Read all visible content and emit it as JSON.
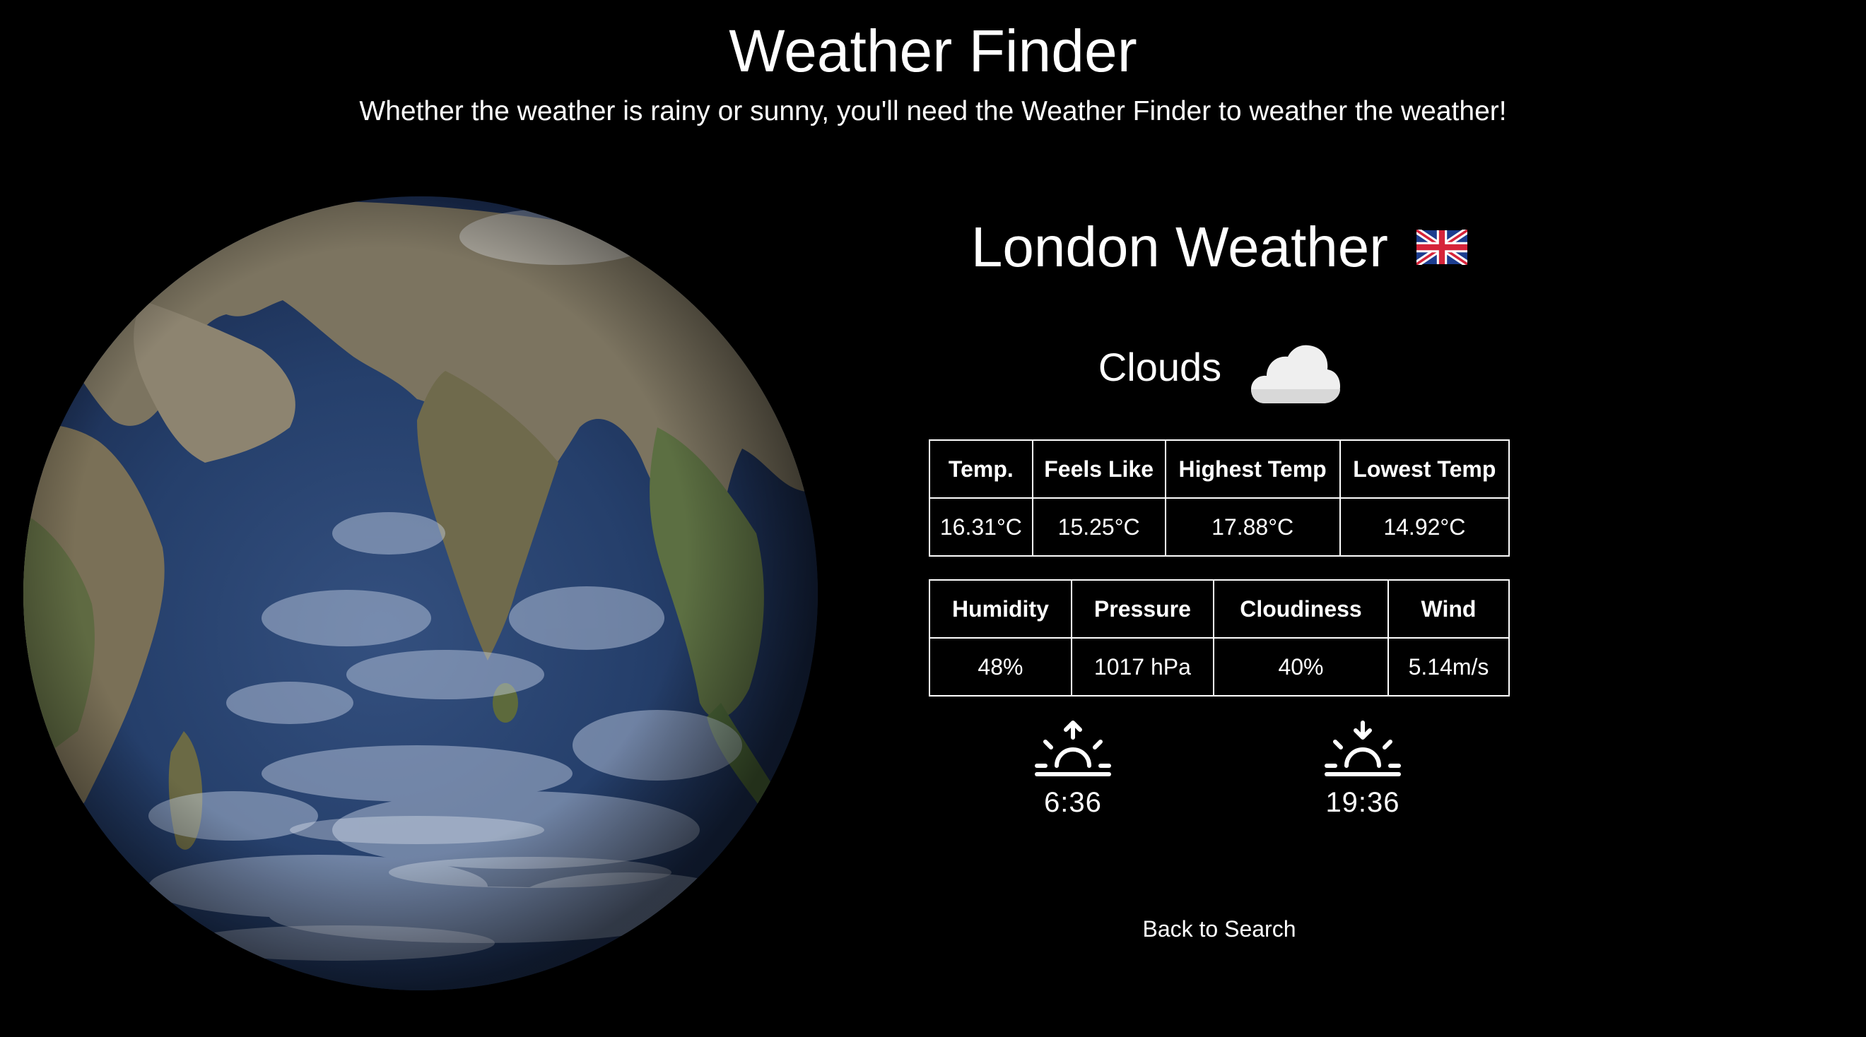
{
  "header": {
    "title": "Weather Finder",
    "tagline": "Whether the weather is rainy or sunny, you'll need the Weather Finder to weather the weather!"
  },
  "weather": {
    "city_heading": "London Weather",
    "flag_icon": "uk-flag-icon",
    "condition": "Clouds",
    "condition_icon": "cloud-icon",
    "temperature_table": {
      "headers": [
        "Temp.",
        "Feels Like",
        "Highest Temp",
        "Lowest Temp"
      ],
      "values": [
        "16.31°C",
        "15.25°C",
        "17.88°C",
        "14.92°C"
      ]
    },
    "conditions_table": {
      "headers": [
        "Humidity",
        "Pressure",
        "Cloudiness",
        "Wind"
      ],
      "values": [
        "48%",
        "1017 hPa",
        "40%",
        "5.14m/s"
      ]
    },
    "sunrise": {
      "icon": "sunrise-icon",
      "time": "6:36"
    },
    "sunset": {
      "icon": "sunset-icon",
      "time": "19:36"
    },
    "back_link": "Back to Search"
  },
  "colors": {
    "background": "#000000",
    "text": "#ffffff"
  }
}
